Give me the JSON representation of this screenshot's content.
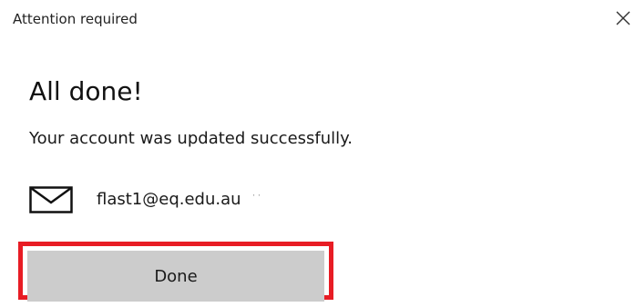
{
  "window": {
    "title": "Attention required",
    "close_icon": "close-icon"
  },
  "dialog": {
    "heading": "All done!",
    "message": "Your account was updated successfully.",
    "account": {
      "icon": "mail-icon",
      "email": "flast1@eq.edu.au",
      "trailing_marks": "··"
    },
    "done_label": "Done"
  },
  "colors": {
    "highlight": "#e81c24",
    "button_bg": "#cccccc",
    "background": "#ffffff"
  }
}
